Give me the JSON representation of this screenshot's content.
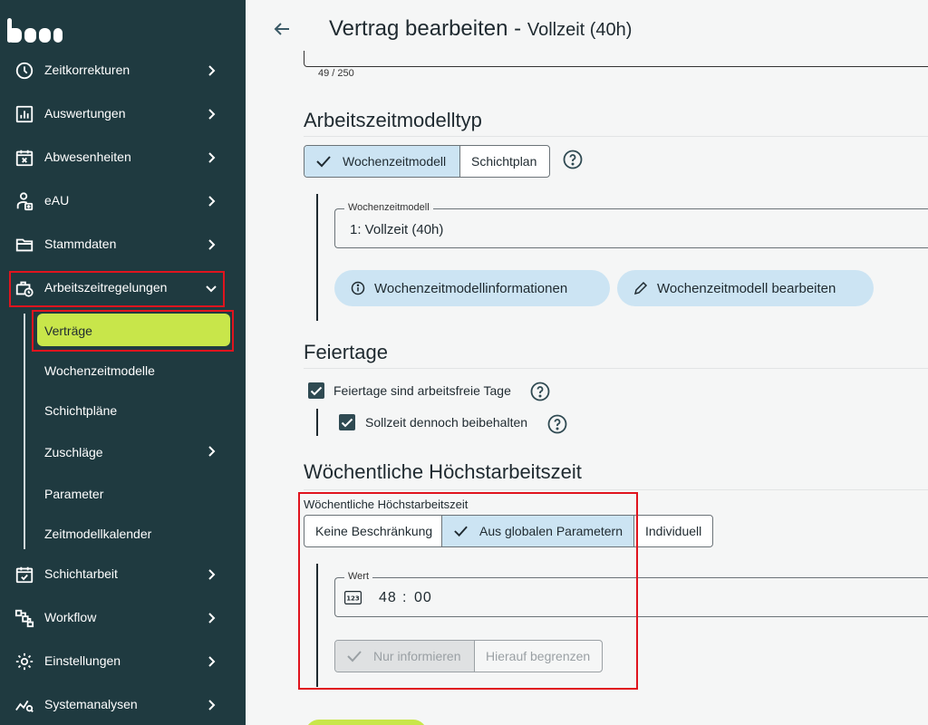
{
  "header": {
    "title": "Vertrag bearbeiten",
    "separator": "-",
    "subtitle": "Vollzeit (40h)"
  },
  "description": {
    "counter": "49 / 250"
  },
  "sidebar": {
    "items": [
      {
        "label": "Zeitkorrekturen",
        "icon": "clock-icon"
      },
      {
        "label": "Auswertungen",
        "icon": "chart-icon"
      },
      {
        "label": "Abwesenheiten",
        "icon": "calendar-x-icon"
      },
      {
        "label": "eAU",
        "icon": "person-medical-icon"
      },
      {
        "label": "Stammdaten",
        "icon": "folder-icon"
      },
      {
        "label": "Arbeitszeitregelungen",
        "icon": "briefcase-clock-icon"
      },
      {
        "label": "Schichtarbeit",
        "icon": "calendar-check-icon"
      },
      {
        "label": "Workflow",
        "icon": "workflow-icon"
      },
      {
        "label": "Einstellungen",
        "icon": "gear-icon"
      },
      {
        "label": "Systemanalysen",
        "icon": "analytics-icon"
      }
    ],
    "subitems": [
      {
        "label": "Verträge"
      },
      {
        "label": "Wochenzeitmodelle"
      },
      {
        "label": "Schichtpläne"
      },
      {
        "label": "Zuschläge"
      },
      {
        "label": "Parameter"
      },
      {
        "label": "Zeitmodellkalender"
      }
    ]
  },
  "model_type": {
    "title": "Arbeitszeitmodelltyp",
    "options": [
      "Wochenzeitmodell",
      "Schichtplan"
    ],
    "selected": "Wochenzeitmodell",
    "field_label": "Wochenzeitmodell",
    "field_value": "1: Vollzeit (40h)",
    "info_button": "Wochenzeitmodellinformationen",
    "edit_button": "Wochenzeitmodell bearbeiten"
  },
  "holidays": {
    "title": "Feiertage",
    "checkbox1": "Feiertage sind arbeitsfreie Tage",
    "checkbox2": "Sollzeit dennoch beibehalten"
  },
  "max_hours": {
    "title": "Wöchentliche Höchstarbeitszeit",
    "label": "Wöchentliche Höchstarbeitszeit",
    "options": [
      "Keine Beschränkung",
      "Aus globalen Parametern",
      "Individuell"
    ],
    "selected": "Aus globalen Parametern",
    "value_label": "Wert",
    "hours": "48",
    "colon": ":",
    "minutes": "00",
    "mode_options": [
      "Nur informieren",
      "Hierauf begrenzen"
    ],
    "mode_selected": "Nur informieren"
  },
  "colors": {
    "sidebar_bg": "#1f3a40",
    "accent_green": "#c8e64a",
    "selected_blue": "#cce4f3",
    "highlight_red": "#e0141e"
  }
}
